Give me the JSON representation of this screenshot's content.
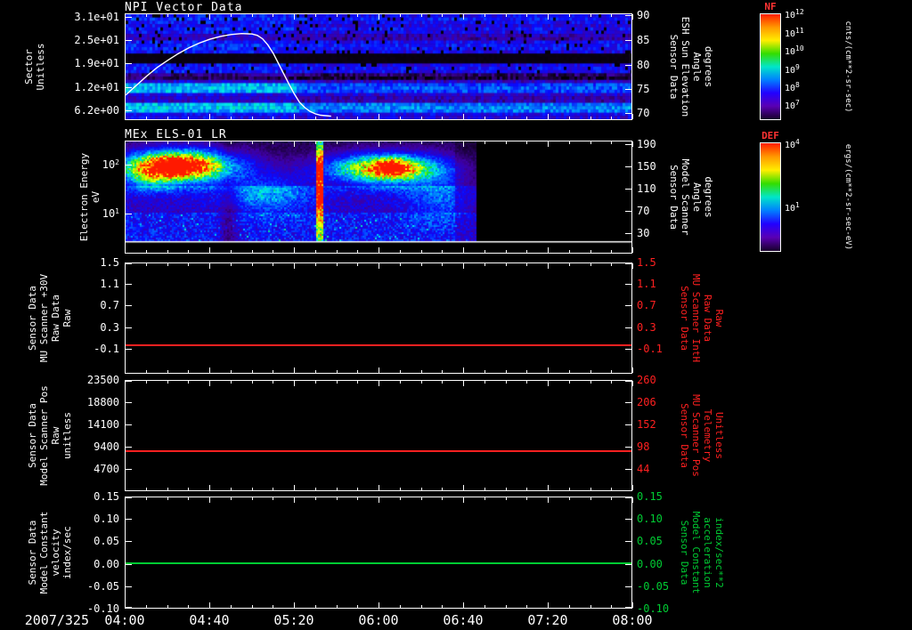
{
  "time_axis": {
    "date": "2007/325",
    "tick_labels": [
      "04:00",
      "04:40",
      "05:20",
      "06:00",
      "06:40",
      "07:20",
      "08:00"
    ]
  },
  "panels": [
    {
      "key": "npi",
      "title": "NPI Vector Data",
      "left_label_lines": [
        "Sector",
        "Unitless"
      ],
      "left_ticks": [
        {
          "label": "3.1e+01",
          "frac": 0.03
        },
        {
          "label": "2.5e+01",
          "frac": 0.25
        },
        {
          "label": "1.9e+01",
          "frac": 0.47
        },
        {
          "label": "1.2e+01",
          "frac": 0.69
        },
        {
          "label": "6.2e+00",
          "frac": 0.91
        }
      ],
      "right_label_lines": [
        "Sensor Data",
        "ESH Sun Elevation",
        "Angle",
        "degrees"
      ],
      "right_color": "#ffffff",
      "right_ticks": [
        {
          "label": "90",
          "frac": 0.02
        },
        {
          "label": "85",
          "frac": 0.25
        },
        {
          "label": "80",
          "frac": 0.48
        },
        {
          "label": "75",
          "frac": 0.71
        },
        {
          "label": "70",
          "frac": 0.93
        }
      ],
      "colorbar": {
        "title": "NF",
        "title_color": "#ff3333",
        "units": "cnts/(cm**2-sr-sec)",
        "ticks": [
          {
            "label": "10^12",
            "frac": 0.02
          },
          {
            "label": "10^11",
            "frac": 0.19
          },
          {
            "label": "10^10",
            "frac": 0.36
          },
          {
            "label": "10^9",
            "frac": 0.53
          },
          {
            "label": "10^8",
            "frac": 0.7
          },
          {
            "label": "10^7",
            "frac": 0.87
          }
        ],
        "gradient": [
          "#ff1e00",
          "#ff9900",
          "#ffee00",
          "#33dd00",
          "#00e6c8",
          "#0080ff",
          "#2200ff",
          "#5a00b4",
          "#17002a"
        ]
      }
    },
    {
      "key": "els",
      "title": "MEx ELS-01 LR",
      "left_label_lines": [
        "Electron Energy",
        "eV"
      ],
      "left_ticks": [
        {
          "label": "10^2",
          "frac": 0.21
        },
        {
          "label": "10^1",
          "frac": 0.645
        }
      ],
      "right_label_lines": [
        "Sensor Data",
        "Model Scanner",
        "Angle",
        "degrees"
      ],
      "right_color": "#ffffff",
      "right_ticks": [
        {
          "label": "190",
          "frac": 0.03
        },
        {
          "label": "150",
          "frac": 0.23
        },
        {
          "label": "110",
          "frac": 0.425
        },
        {
          "label": "70",
          "frac": 0.62
        },
        {
          "label": "30",
          "frac": 0.82
        }
      ],
      "colorbar": {
        "title": "DEF",
        "title_color": "#ff3333",
        "units": "ergs/(cm**2-sr-sec-eV)",
        "ticks": [
          {
            "label": "10^4",
            "frac": 0.02
          },
          {
            "label": "10^1",
            "frac": 0.6
          }
        ],
        "gradient": [
          "#ff1e00",
          "#ff9900",
          "#ffee00",
          "#33dd00",
          "#00e6c8",
          "#0080ff",
          "#2200ff",
          "#5a00b4",
          "#17002a"
        ]
      }
    },
    {
      "key": "mu-scanner-raw",
      "title": "",
      "left_label_lines": [
        "Sensor Data",
        "MU Scanner +30V",
        "Raw Data",
        "Raw"
      ],
      "left_ticks": [
        {
          "label": "1.5",
          "frac": 0.0
        },
        {
          "label": "1.1",
          "frac": 0.193
        },
        {
          "label": "0.7",
          "frac": 0.387
        },
        {
          "label": "0.3",
          "frac": 0.58
        },
        {
          "label": "-0.1",
          "frac": 0.774
        }
      ],
      "right_label_lines": [
        "Sensor Data",
        "MU Scanner IntH",
        "Raw Data",
        "Raw"
      ],
      "right_color": "#ff2020",
      "right_ticks": [
        {
          "label": "1.5",
          "frac": 0.0
        },
        {
          "label": "1.1",
          "frac": 0.193
        },
        {
          "label": "0.7",
          "frac": 0.387
        },
        {
          "label": "0.3",
          "frac": 0.58
        },
        {
          "label": "-0.1",
          "frac": 0.774
        }
      ]
    },
    {
      "key": "scanner-pos",
      "title": "",
      "left_label_lines": [
        "Sensor Data",
        "Model Scanner Pos",
        "Raw",
        "unitless"
      ],
      "left_ticks": [
        {
          "label": "23500",
          "frac": 0.0
        },
        {
          "label": "18800",
          "frac": 0.2
        },
        {
          "label": "14100",
          "frac": 0.4
        },
        {
          "label": "9400",
          "frac": 0.6
        },
        {
          "label": "4700",
          "frac": 0.8
        }
      ],
      "right_label_lines": [
        "Sensor Data",
        "MU Scanner Pos",
        "Telemetry",
        "Unitless"
      ],
      "right_color": "#ff2020",
      "right_ticks": [
        {
          "label": "260",
          "frac": 0.0
        },
        {
          "label": "206",
          "frac": 0.2
        },
        {
          "label": "152",
          "frac": 0.4
        },
        {
          "label": "98",
          "frac": 0.6
        },
        {
          "label": "44",
          "frac": 0.8
        }
      ]
    },
    {
      "key": "model-constant",
      "title": "",
      "left_label_lines": [
        "Sensor Data",
        "Model Constant",
        "velocity",
        "index/sec"
      ],
      "left_ticks": [
        {
          "label": "0.15",
          "frac": 0.0
        },
        {
          "label": "0.10",
          "frac": 0.2
        },
        {
          "label": "0.05",
          "frac": 0.4
        },
        {
          "label": "0.00",
          "frac": 0.6
        },
        {
          "label": "-0.05",
          "frac": 0.8
        },
        {
          "label": "-0.10",
          "frac": 1.0
        }
      ],
      "right_label_lines": [
        "Sensor Data",
        "Model Constant",
        "acceleration",
        "index/sec**2"
      ],
      "right_color": "#00cc33",
      "right_ticks": [
        {
          "label": "0.15",
          "frac": 0.0
        },
        {
          "label": "0.10",
          "frac": 0.2
        },
        {
          "label": "0.05",
          "frac": 0.4
        },
        {
          "label": "0.00",
          "frac": 0.6
        },
        {
          "label": "-0.05",
          "frac": 0.8
        },
        {
          "label": "-0.10",
          "frac": 1.0
        }
      ]
    }
  ],
  "chart_data": [
    {
      "type": "heatmap",
      "panel": 1,
      "title": "NPI Vector Data",
      "x_axis": {
        "label": "time",
        "start": "04:00",
        "end": "08:00",
        "date": "2007/325"
      },
      "y_axis": {
        "label": "Sector Unitless",
        "range": [
          0,
          33
        ],
        "ticks": [
          31,
          25,
          19,
          12,
          6.2
        ]
      },
      "colorbar": {
        "name": "NF",
        "units": "cnts/(cm**2-sr-sec)",
        "tick_labels": [
          "10^12",
          "10^11",
          "10^10",
          "10^9",
          "10^8",
          "10^7"
        ]
      },
      "features": "mostly blue-purple counts across all sectors for full interval; black dropout bands near sectors 13-15 and 18-19; bright cyan band near sectors 2-4; overall intensity enhanced before 05:20; scattered black speckles in upper sectors"
    },
    {
      "type": "line",
      "panel": 1,
      "name": "ESH Sun Elevation Angle",
      "units": "degrees",
      "color": "#ffffff",
      "axis_range": [
        90,
        70
      ],
      "x_hours": [
        4.0,
        4.083,
        4.167,
        4.25,
        4.333,
        4.417,
        4.5,
        4.583,
        4.667,
        4.75,
        4.833,
        4.917,
        5.0,
        5.042,
        5.083,
        5.125,
        5.167,
        5.208,
        5.25,
        5.292,
        5.333,
        5.375,
        5.417,
        5.458,
        5.5,
        5.542,
        5.583,
        5.625
      ],
      "y_values": [
        73.5,
        75.5,
        77.5,
        79.3,
        80.8,
        82.2,
        83.4,
        84.4,
        85.2,
        85.8,
        86.2,
        86.4,
        86.3,
        86.0,
        85.3,
        84.0,
        82.3,
        80.2,
        78.0,
        75.8,
        73.8,
        72.0,
        70.9,
        70.1,
        69.6,
        69.3,
        69.2,
        69.1
      ]
    },
    {
      "type": "heatmap",
      "panel": 2,
      "title": "MEx ELS-01 LR",
      "x_axis": {
        "label": "time",
        "start": "04:00",
        "end": "06:47"
      },
      "y_axis": {
        "label": "Electron Energy eV",
        "scale": "log",
        "range_eV": [
          1.5,
          300
        ],
        "ticks": [
          100,
          10
        ]
      },
      "colorbar": {
        "name": "DEF",
        "units": "ergs/(cm**2-sr-sec-eV)",
        "tick_labels": [
          "10^4",
          "10^1"
        ]
      },
      "features": "intense electron flux (red/yellow) between ~20-150 eV from 04:05-04:50 and 05:40-06:25; narrow intense vertical burst near 05:31; diffuse blue/cyan background at low energies; data gap (black) after ~06:47; white baseline near panel bottom"
    },
    {
      "type": "line",
      "panel": 3,
      "name": "MU Scanner +30V Raw Data / MU Scanner IntH Raw Data",
      "color": "#ff2020",
      "axis_range": [
        1.5,
        -0.5
      ],
      "constant_value": 0.0
    },
    {
      "type": "line",
      "panel": 4,
      "name": "Model Scanner Pos Raw / MU Scanner Pos Telemetry",
      "color": "#ff2020",
      "axis_range": [
        23500,
        0
      ],
      "constant_value": 8460
    },
    {
      "type": "line",
      "panel": 5,
      "name": "Model Constant velocity / acceleration",
      "color": "#00cc33",
      "axis_range": [
        0.15,
        -0.1
      ],
      "constant_value": 0.0
    }
  ]
}
